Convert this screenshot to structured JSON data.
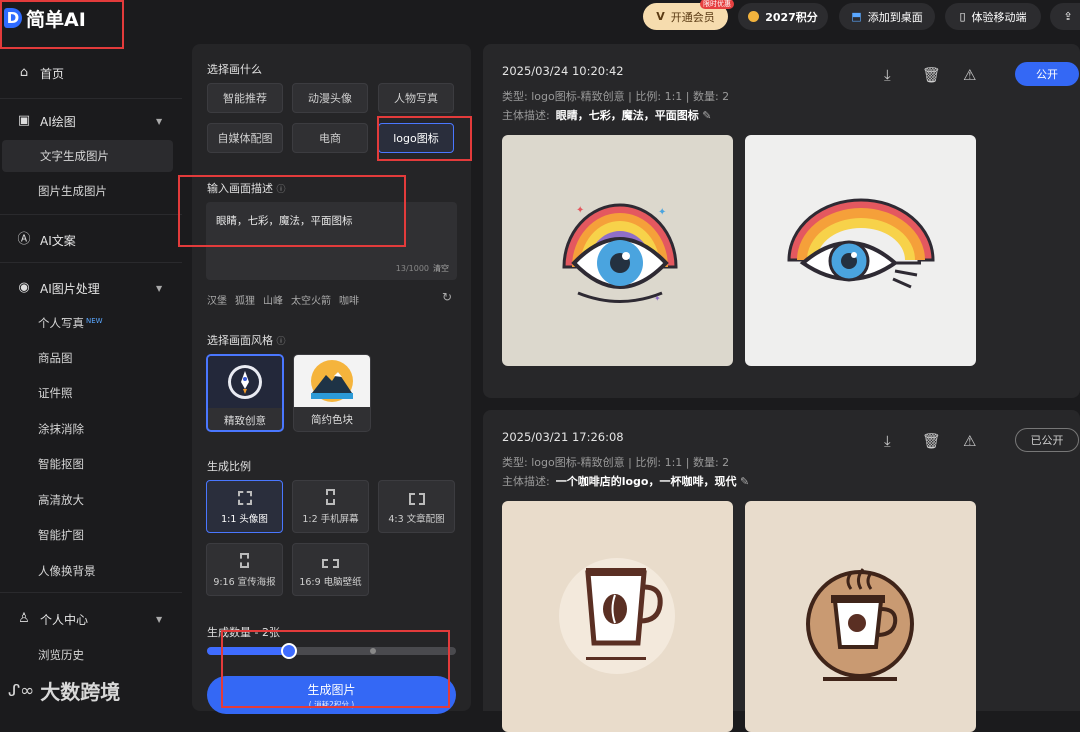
{
  "app": {
    "title": "简单AI",
    "logo_letter": "D"
  },
  "topbar": {
    "vip_label": "开通会员",
    "vip_badge": "限时优惠",
    "points_label": "2027积分",
    "desktop_label": "添加到桌面",
    "mobile_label": "体验移动端"
  },
  "sidebar": {
    "home": "首页",
    "ai_drawing": "AI绘图",
    "text_to_image": "文字生成图片",
    "image_to_image": "图片生成图片",
    "ai_copy": "AI文案",
    "ai_image_proc": "AI图片处理",
    "proc_items": [
      "个人写真",
      "商品图",
      "证件照",
      "涂抹消除",
      "智能抠图",
      "高清放大",
      "智能扩图",
      "人像换背景"
    ],
    "new_badge": "NEW",
    "personal_center": "个人中心",
    "history": "浏览历史"
  },
  "panel": {
    "choose_title": "选择画什么",
    "categories": [
      "智能推荐",
      "动漫头像",
      "人物写真",
      "自媒体配图",
      "电商",
      "logo图标"
    ],
    "selected_category": "logo图标",
    "desc_title": "输入画面描述",
    "desc_value": "眼睛，七彩，魔法，平面图标",
    "counter": "13/1000",
    "clear_label": "清空",
    "tags": [
      "汉堡",
      "狐狸",
      "山峰",
      "太空火箭",
      "咖啡"
    ],
    "style_title": "选择画面风格",
    "styles": [
      "精致创意",
      "简约色块"
    ],
    "ratio_title": "生成比例",
    "ratios": [
      "1:1 头像图",
      "1:2 手机屏幕",
      "4:3 文章配图",
      "9:16 宣传海报",
      "16:9 电脑壁纸"
    ],
    "count_title": "生成数量 - 2张",
    "count_fraction": 0.33,
    "generate_label": "生成图片",
    "generate_sub": "( 消耗2积分 )"
  },
  "results": [
    {
      "date": "2025/03/24 10:20:42",
      "meta": "类型: logo图标-精致创意 | 比例: 1:1 | 数量: 2",
      "desc_label": "主体描述:",
      "desc": "眼睛，七彩，魔法，平面图标",
      "public_label": "公开",
      "public_state": "on"
    },
    {
      "date": "2025/03/21 17:26:08",
      "meta": "类型: logo图标-精致创意 | 比例: 1:1 | 数量: 2",
      "desc_label": "主体描述:",
      "desc": "一个咖啡店的logo，一杯咖啡，现代",
      "public_label": "已公开",
      "public_state": "off"
    }
  ],
  "watermark": "大数跨境",
  "colors": {
    "accent": "#3468f5",
    "highlight_box": "#e33b3b",
    "background": "#1b1b1d"
  }
}
